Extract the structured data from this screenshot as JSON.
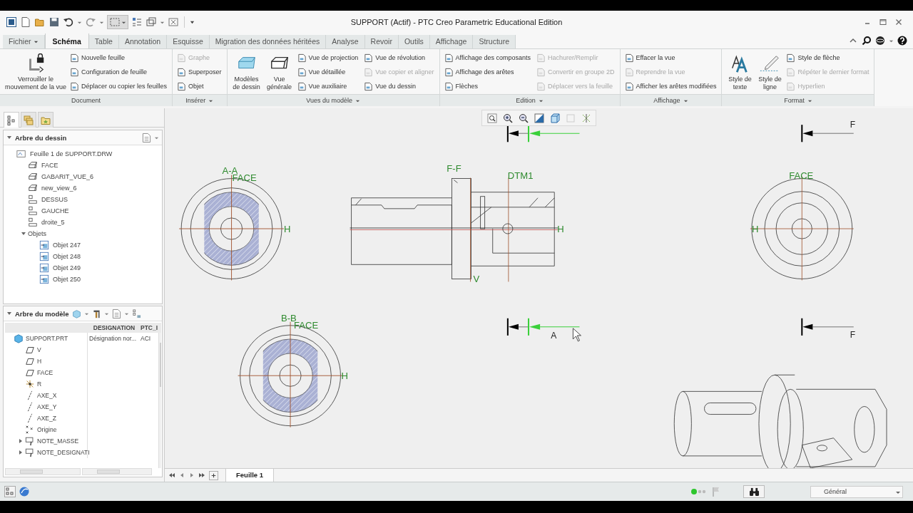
{
  "window": {
    "title": "SUPPORT (Actif) - PTC Creo Parametric Educational Edition"
  },
  "tabs": [
    {
      "label": "Fichier",
      "kind": "menu",
      "selected": false
    },
    {
      "label": "Schéma",
      "kind": "tab",
      "selected": true
    },
    {
      "label": "Table",
      "kind": "tab",
      "selected": false
    },
    {
      "label": "Annotation",
      "kind": "tab",
      "selected": false
    },
    {
      "label": "Esquisse",
      "kind": "tab",
      "selected": false
    },
    {
      "label": "Migration des données héritées",
      "kind": "tab",
      "selected": false
    },
    {
      "label": "Analyse",
      "kind": "tab",
      "selected": false
    },
    {
      "label": "Revoir",
      "kind": "tab",
      "selected": false
    },
    {
      "label": "Outils",
      "kind": "tab",
      "selected": false
    },
    {
      "label": "Affichage",
      "kind": "tab",
      "selected": false
    },
    {
      "label": "Structure",
      "kind": "tab",
      "selected": false
    }
  ],
  "ribbon": {
    "groups": [
      {
        "label": "Document",
        "dropdown": false,
        "big": [
          {
            "label": "Verrouiller le mouvement de la vue",
            "kind": "lock"
          }
        ],
        "columns": [
          [
            {
              "label": "Nouvelle feuille",
              "disabled": false
            },
            {
              "label": "Configuration de feuille",
              "disabled": false
            },
            {
              "label": "Déplacer ou copier les feuilles",
              "disabled": false
            }
          ]
        ]
      },
      {
        "label": "Insérer",
        "dropdown": true,
        "columns": [
          [
            {
              "label": "Graphe",
              "disabled": true
            },
            {
              "label": "Superposer",
              "disabled": false
            },
            {
              "label": "Objet",
              "disabled": false
            }
          ]
        ]
      },
      {
        "label": "Vues du modèle",
        "dropdown": true,
        "big": [
          {
            "label": "Modèles de dessin",
            "kind": "template"
          },
          {
            "label": "Vue générale",
            "kind": "view"
          }
        ],
        "columns": [
          [
            {
              "label": "Vue de projection",
              "disabled": false
            },
            {
              "label": "Vue détaillée",
              "disabled": false
            },
            {
              "label": "Vue auxiliaire",
              "disabled": false
            }
          ],
          [
            {
              "label": "Vue de révolution",
              "disabled": false
            },
            {
              "label": "Vue copier et aligner",
              "disabled": true
            },
            {
              "label": "Vue du dessin",
              "disabled": false
            }
          ]
        ]
      },
      {
        "label": "Edition",
        "dropdown": true,
        "columns": [
          [
            {
              "label": "Affichage des composants",
              "disabled": false
            },
            {
              "label": "Affichage des arêtes",
              "disabled": false
            },
            {
              "label": "Flèches",
              "disabled": false
            }
          ],
          [
            {
              "label": "Hachurer/Remplir",
              "disabled": true
            },
            {
              "label": "Convertir en groupe 2D",
              "disabled": true
            },
            {
              "label": "Déplacer vers la feuille",
              "disabled": true
            }
          ]
        ]
      },
      {
        "label": "Affichage",
        "dropdown": true,
        "columns": [
          [
            {
              "label": "Effacer la vue",
              "disabled": false
            },
            {
              "label": "Reprendre la vue",
              "disabled": true
            },
            {
              "label": "Afficher les arêtes modifiées",
              "disabled": false
            }
          ]
        ]
      },
      {
        "label": "Format",
        "dropdown": true,
        "big": [
          {
            "label": "Style de texte",
            "kind": "text-style"
          },
          {
            "label": "Style de ligne",
            "kind": "line-style"
          }
        ],
        "columns": [
          [
            {
              "label": "Style de flèche",
              "disabled": false
            },
            {
              "label": "Répéter le dernier format",
              "disabled": true
            },
            {
              "label": "Hyperlien",
              "disabled": true
            }
          ]
        ]
      }
    ]
  },
  "panel_tabs": [
    {
      "kind": "tree",
      "selected": true
    },
    {
      "kind": "layers",
      "selected": false
    },
    {
      "kind": "favorites",
      "selected": false
    }
  ],
  "drawing_tree": {
    "title": "Arbre du dessin",
    "expanded": true,
    "items": [
      {
        "label": "Feuille 1 de SUPPORT.DRW",
        "kind": "sheet",
        "children": [
          {
            "label": "FACE",
            "kind": "view3d"
          },
          {
            "label": "GABARIT_VUE_6",
            "kind": "view3d"
          },
          {
            "label": "new_view_6",
            "kind": "view3d"
          },
          {
            "label": "DESSUS",
            "kind": "projection"
          },
          {
            "label": "GAUCHE",
            "kind": "projection"
          },
          {
            "label": "droite_5",
            "kind": "projection"
          },
          {
            "label": "Objets",
            "kind": "folder",
            "expanded": true,
            "children": [
              {
                "label": "Objet 247",
                "kind": "object"
              },
              {
                "label": "Objet 248",
                "kind": "object"
              },
              {
                "label": "Objet 249",
                "kind": "object"
              },
              {
                "label": "Objet 250",
                "kind": "object"
              }
            ]
          }
        ]
      }
    ]
  },
  "model_tree": {
    "title": "Arbre du modèle",
    "expanded": true,
    "columns": [
      "DESIGNATION",
      "PTC_I"
    ],
    "rows": [
      {
        "label": "SUPPORT.PRT",
        "kind": "part",
        "cells": [
          "Désignation nor...",
          "ACI"
        ],
        "children": [
          {
            "label": "V",
            "kind": "plane"
          },
          {
            "label": "H",
            "kind": "plane"
          },
          {
            "label": "FACE",
            "kind": "plane"
          },
          {
            "label": "R",
            "kind": "csys"
          },
          {
            "label": "AXE_X",
            "kind": "axis"
          },
          {
            "label": "AXE_Y",
            "kind": "axis"
          },
          {
            "label": "AXE_Z",
            "kind": "axis"
          },
          {
            "label": "Origine",
            "kind": "point"
          },
          {
            "label": "NOTE_MASSE",
            "kind": "note",
            "expanded": false
          },
          {
            "label": "NOTE_DESIGNATI",
            "kind": "note",
            "expanded": false
          }
        ]
      }
    ]
  },
  "canvas": {
    "labels": [
      {
        "text": "F",
        "kind": "arrow"
      },
      {
        "text": "A-A",
        "kind": "view"
      },
      {
        "text": "FACE",
        "kind": "view"
      },
      {
        "text": "F-F",
        "kind": "view"
      },
      {
        "text": "DTM1",
        "kind": "view"
      },
      {
        "text": "FACE",
        "kind": "view"
      },
      {
        "text": "H",
        "kind": "view"
      },
      {
        "text": "H",
        "kind": "view"
      },
      {
        "text": "H",
        "kind": "view"
      },
      {
        "text": "V",
        "kind": "view"
      },
      {
        "text": "B-B",
        "kind": "view"
      },
      {
        "text": "FACE",
        "kind": "view"
      },
      {
        "text": "A",
        "kind": "arrow"
      },
      {
        "text": "F",
        "kind": "arrow"
      },
      {
        "text": "H",
        "kind": "view"
      }
    ]
  },
  "sheets": [
    {
      "label": "Feuille 1",
      "selected": true
    }
  ],
  "status_bar": {
    "filter": "Général"
  }
}
